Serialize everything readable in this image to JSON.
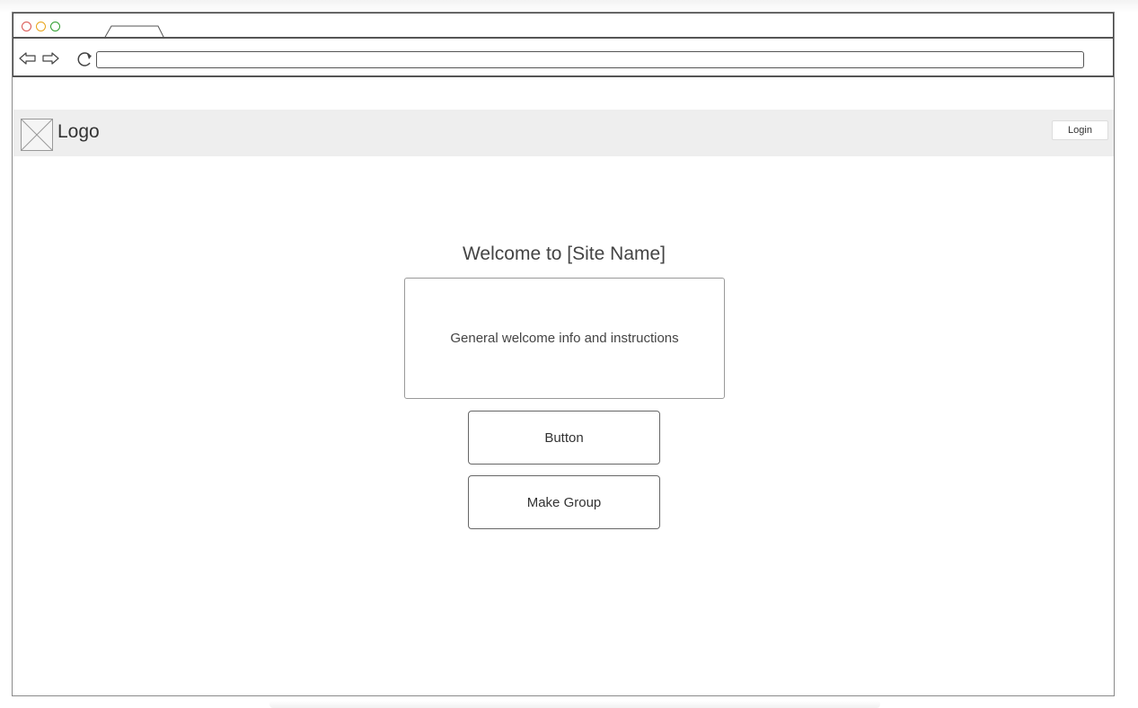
{
  "header": {
    "logo_text": "Logo",
    "login_label": "Login"
  },
  "main": {
    "title": "Welcome to [Site Name]",
    "info_text": "General welcome info and instructions",
    "buttons": [
      {
        "label": "Button"
      },
      {
        "label": "Make Group"
      }
    ]
  },
  "icons": {
    "window_controls": [
      "close-dot-icon",
      "minimize-dot-icon",
      "maximize-dot-icon"
    ],
    "navigation": [
      "back-arrow-icon",
      "forward-arrow-icon",
      "reload-icon"
    ],
    "logo_placeholder": "image-placeholder-icon"
  },
  "colors": {
    "header_bg": "#eeeeee",
    "close_dot": "#d9534f",
    "minimize_dot": "#e8a317",
    "maximize_dot": "#2e9e2e"
  }
}
